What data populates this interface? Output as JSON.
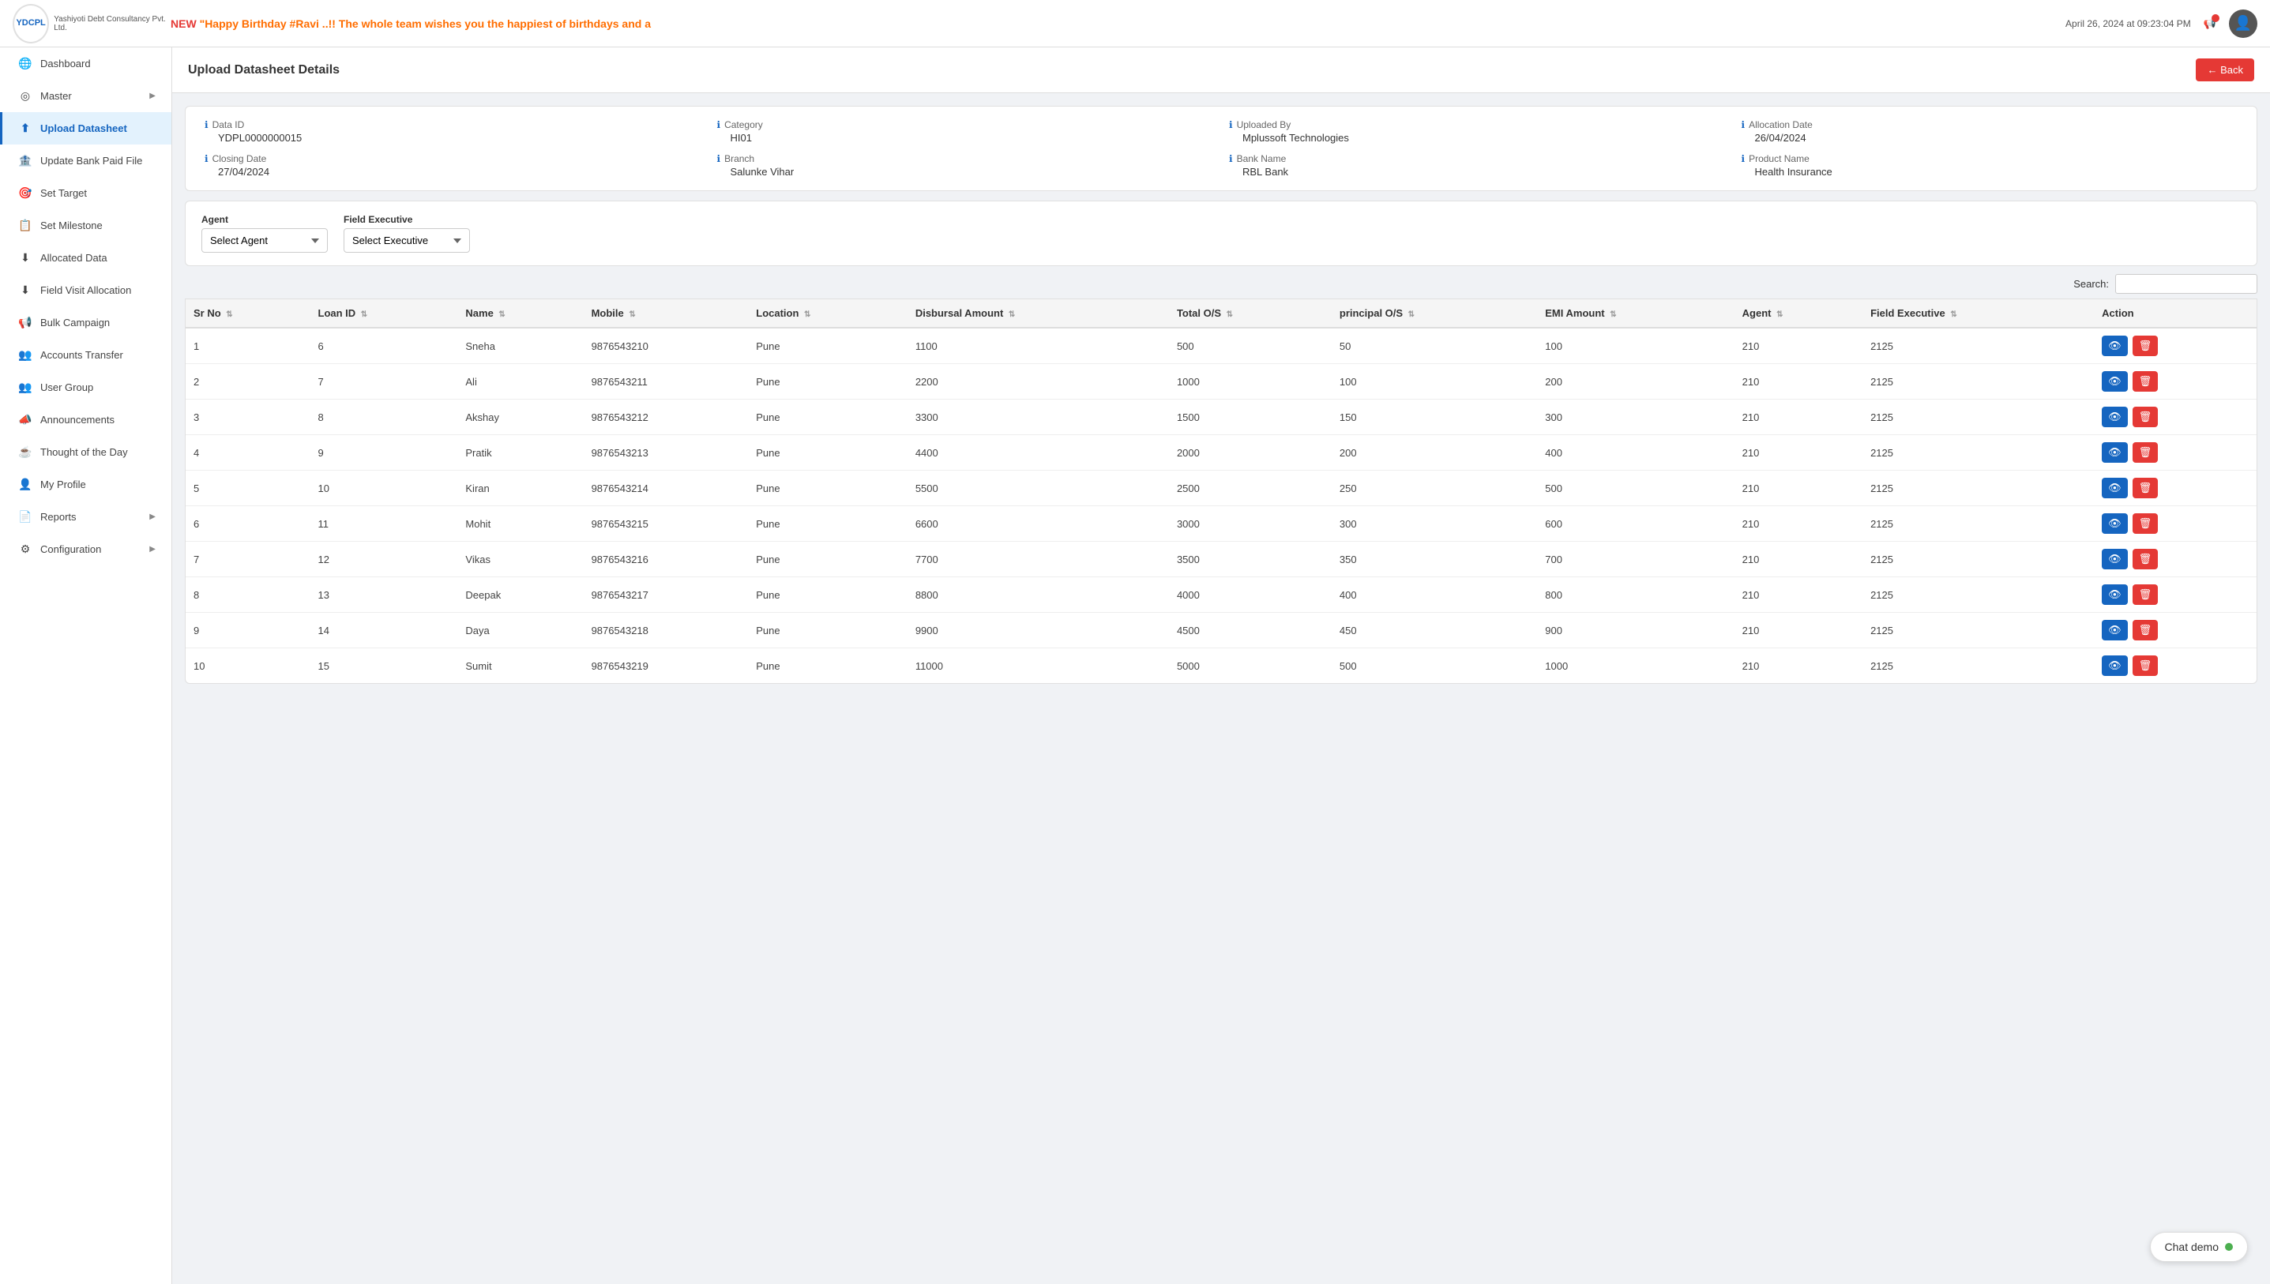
{
  "header": {
    "logo_text": "YDCPL",
    "logo_subtext": "Yashiyoti Debt Consultancy Pvt. Ltd.",
    "marquee": "\"Happy Birthday #Ravi ..!! The whole team wishes you the happiest of birthdays and a",
    "marquee_prefix": "NEW",
    "datetime": "April 26, 2024 at 09:23:04 PM",
    "back_label": "← Back"
  },
  "sidebar": {
    "items": [
      {
        "id": "dashboard",
        "label": "Dashboard",
        "icon": "🌐",
        "has_arrow": false,
        "active": false
      },
      {
        "id": "master",
        "label": "Master",
        "icon": "◎",
        "has_arrow": true,
        "active": false
      },
      {
        "id": "upload-datasheet",
        "label": "Upload Datasheet",
        "icon": "⬆",
        "has_arrow": false,
        "active": true
      },
      {
        "id": "update-bank",
        "label": "Update Bank Paid File",
        "icon": "🏦",
        "has_arrow": false,
        "active": false
      },
      {
        "id": "set-target",
        "label": "Set Target",
        "icon": "🎯",
        "has_arrow": false,
        "active": false
      },
      {
        "id": "set-milestone",
        "label": "Set Milestone",
        "icon": "📋",
        "has_arrow": false,
        "active": false
      },
      {
        "id": "allocated-data",
        "label": "Allocated Data",
        "icon": "⬇",
        "has_arrow": false,
        "active": false
      },
      {
        "id": "field-visit",
        "label": "Field Visit Allocation",
        "icon": "⬇",
        "has_arrow": false,
        "active": false
      },
      {
        "id": "bulk-campaign",
        "label": "Bulk Campaign",
        "icon": "📢",
        "has_arrow": false,
        "active": false
      },
      {
        "id": "accounts-transfer",
        "label": "Accounts Transfer",
        "icon": "👥",
        "has_arrow": false,
        "active": false
      },
      {
        "id": "user-group",
        "label": "User Group",
        "icon": "👥",
        "has_arrow": false,
        "active": false
      },
      {
        "id": "announcements",
        "label": "Announcements",
        "icon": "📣",
        "has_arrow": false,
        "active": false
      },
      {
        "id": "thought-of-day",
        "label": "Thought of the Day",
        "icon": "☕",
        "has_arrow": false,
        "active": false
      },
      {
        "id": "my-profile",
        "label": "My Profile",
        "icon": "👤",
        "has_arrow": false,
        "active": false
      },
      {
        "id": "reports",
        "label": "Reports",
        "icon": "📄",
        "has_arrow": true,
        "active": false
      },
      {
        "id": "configuration",
        "label": "Configuration",
        "icon": "⚙",
        "has_arrow": true,
        "active": false
      }
    ]
  },
  "page": {
    "title": "Upload Datasheet Details"
  },
  "info_card": {
    "fields": [
      {
        "label": "Data ID",
        "value": "YDPL0000000015"
      },
      {
        "label": "Category",
        "value": "HI01"
      },
      {
        "label": "Uploaded By",
        "value": "Mplussoft Technologies"
      },
      {
        "label": "Allocation Date",
        "value": "26/04/2024"
      },
      {
        "label": "Closing Date",
        "value": "27/04/2024"
      },
      {
        "label": "Branch",
        "value": "Salunke Vihar"
      },
      {
        "label": "Bank Name",
        "value": "RBL Bank"
      },
      {
        "label": "Product Name",
        "value": "Health Insurance"
      }
    ]
  },
  "filter": {
    "agent_label": "Agent",
    "agent_placeholder": "Select Agent",
    "executive_label": "Field Executive",
    "executive_placeholder": "Select Executive"
  },
  "search": {
    "label": "Search:",
    "placeholder": ""
  },
  "table": {
    "columns": [
      "Sr No",
      "Loan ID",
      "Name",
      "Mobile",
      "Location",
      "Disbursal Amount",
      "Total O/S",
      "principal O/S",
      "EMI Amount",
      "Agent",
      "Field Executive",
      "Action"
    ],
    "rows": [
      {
        "sr": 1,
        "loan_id": 6,
        "name": "Sneha",
        "mobile": "9876543210",
        "location": "Pune",
        "disbursal": 1100,
        "total_os": 500,
        "principal_os": 50,
        "emi": 100,
        "agent": 210,
        "executive": 2125
      },
      {
        "sr": 2,
        "loan_id": 7,
        "name": "Ali",
        "mobile": "9876543211",
        "location": "Pune",
        "disbursal": 2200,
        "total_os": 1000,
        "principal_os": 100,
        "emi": 200,
        "agent": 210,
        "executive": 2125
      },
      {
        "sr": 3,
        "loan_id": 8,
        "name": "Akshay",
        "mobile": "9876543212",
        "location": "Pune",
        "disbursal": 3300,
        "total_os": 1500,
        "principal_os": 150,
        "emi": 300,
        "agent": 210,
        "executive": 2125
      },
      {
        "sr": 4,
        "loan_id": 9,
        "name": "Pratik",
        "mobile": "9876543213",
        "location": "Pune",
        "disbursal": 4400,
        "total_os": 2000,
        "principal_os": 200,
        "emi": 400,
        "agent": 210,
        "executive": 2125
      },
      {
        "sr": 5,
        "loan_id": 10,
        "name": "Kiran",
        "mobile": "9876543214",
        "location": "Pune",
        "disbursal": 5500,
        "total_os": 2500,
        "principal_os": 250,
        "emi": 500,
        "agent": 210,
        "executive": 2125
      },
      {
        "sr": 6,
        "loan_id": 11,
        "name": "Mohit",
        "mobile": "9876543215",
        "location": "Pune",
        "disbursal": 6600,
        "total_os": 3000,
        "principal_os": 300,
        "emi": 600,
        "agent": 210,
        "executive": 2125
      },
      {
        "sr": 7,
        "loan_id": 12,
        "name": "Vikas",
        "mobile": "9876543216",
        "location": "Pune",
        "disbursal": 7700,
        "total_os": 3500,
        "principal_os": 350,
        "emi": 700,
        "agent": 210,
        "executive": 2125
      },
      {
        "sr": 8,
        "loan_id": 13,
        "name": "Deepak",
        "mobile": "9876543217",
        "location": "Pune",
        "disbursal": 8800,
        "total_os": 4000,
        "principal_os": 400,
        "emi": 800,
        "agent": 210,
        "executive": 2125
      },
      {
        "sr": 9,
        "loan_id": 14,
        "name": "Daya",
        "mobile": "9876543218",
        "location": "Pune",
        "disbursal": 9900,
        "total_os": 4500,
        "principal_os": 450,
        "emi": 900,
        "agent": 210,
        "executive": 2125
      },
      {
        "sr": 10,
        "loan_id": 15,
        "name": "Sumit",
        "mobile": "9876543219",
        "location": "Pune",
        "disbursal": 11000,
        "total_os": 5000,
        "principal_os": 500,
        "emi": 1000,
        "agent": 210,
        "executive": 2125
      }
    ],
    "view_label": "👁",
    "delete_label": "🗑"
  },
  "chat": {
    "label": "Chat demo"
  }
}
